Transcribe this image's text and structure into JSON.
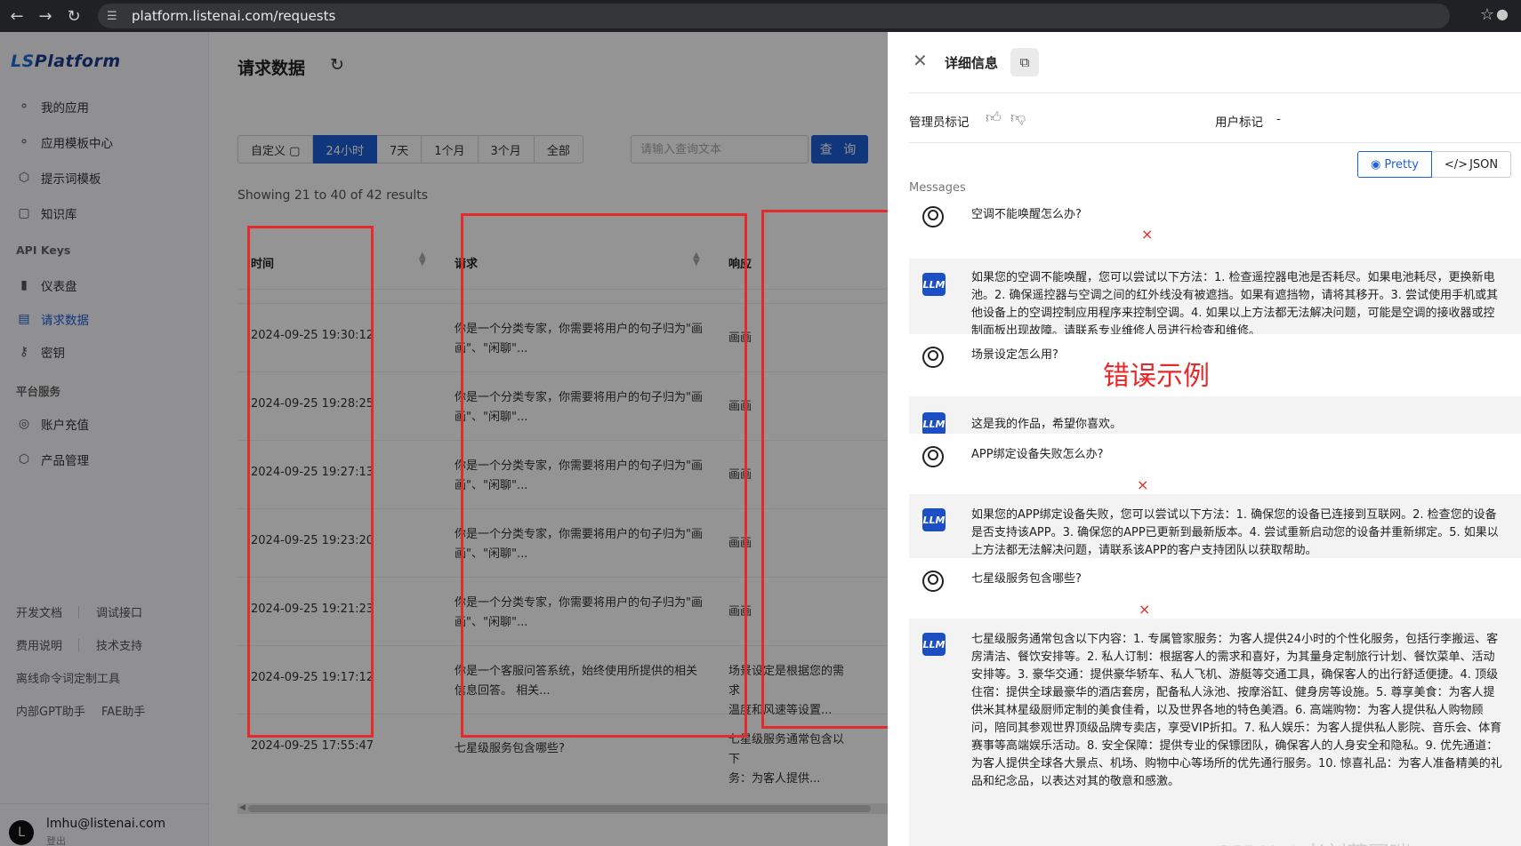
{
  "browser": {
    "url": "platform.listenai.com/requests"
  },
  "sidebar": {
    "logo_prefix": "LS",
    "logo_suffix": "Platform",
    "items": [
      {
        "label": "我的应用"
      },
      {
        "label": "应用模板中心"
      },
      {
        "label": "提示词模板"
      },
      {
        "label": "知识库"
      }
    ],
    "section_api": "API Keys",
    "api_items": [
      {
        "label": "仪表盘"
      },
      {
        "label": "请求数据"
      },
      {
        "label": "密钥"
      }
    ],
    "section_platform": "平台服务",
    "platform_items": [
      {
        "label": "账户充值"
      },
      {
        "label": "产品管理"
      }
    ],
    "links": [
      "开发文档",
      "调试接口",
      "费用说明",
      "技术支持",
      "离线命令词定制工具",
      "内部GPT助手",
      "FAE助手"
    ],
    "user_email": "lmhu@listenai.com",
    "user_avatar": "L",
    "logout": "登出"
  },
  "main": {
    "title": "请求数据",
    "filters": [
      "自定义 ▢",
      "24小时",
      "7天",
      "1个月",
      "3个月",
      "全部"
    ],
    "search_placeholder": "请输入查询文本",
    "search_button": "查 询",
    "showing": "Showing 21 to 40 of 42 results",
    "columns": [
      "时间",
      "请求",
      "响应"
    ],
    "rows": [
      {
        "time": "2024-09-25 19:30:12",
        "request": "你是一个分类专家，你需要将用户的句子归为\"画画\"、\"闲聊\"...",
        "response": "画画"
      },
      {
        "time": "2024-09-25 19:28:25",
        "request": "你是一个分类专家，你需要将用户的句子归为\"画画\"、\"闲聊\"...",
        "response": "画画"
      },
      {
        "time": "2024-09-25 19:27:13",
        "request": "你是一个分类专家，你需要将用户的句子归为\"画画\"、\"闲聊\"...",
        "response": "画画"
      },
      {
        "time": "2024-09-25 19:23:20",
        "request": "你是一个分类专家，你需要将用户的句子归为\"画画\"、\"闲聊\"...",
        "response": "画画"
      },
      {
        "time": "2024-09-25 19:21:23",
        "request": "你是一个分类专家，你需要将用户的句子归为\"画画\"、\"闲聊\"...",
        "response": "画画"
      },
      {
        "time": "2024-09-25 19:17:12",
        "request": "你是一个客服问答系统，始终使用所提供的相关信息回答。 相关...",
        "response": "场景设定是根据您的需求\n温度和风速等设置..."
      },
      {
        "time": "2024-09-25 17:55:47",
        "request": "七星级服务包含哪些?",
        "response": "七星级服务通常包含以下\n务：为客人提供..."
      }
    ]
  },
  "panel": {
    "title": "详细信息",
    "admin_label": "管理员标记",
    "user_mark_label": "用户标记",
    "user_mark_value": "-",
    "pretty": "Pretty",
    "json": "JSON",
    "messages_label": "Messages",
    "llm_badge": "LLM",
    "messages": [
      {
        "role": "user",
        "text": "空调不能唤醒怎么办?"
      },
      {
        "role": "llm",
        "text": "如果您的空调不能唤醒，您可以尝试以下方法：1. 检查遥控器电池是否耗尽。如果电池耗尽，更换新电池。2. 确保遥控器与空调之间的红外线没有被遮挡。如果有遮挡物，请将其移开。3. 尝试使用手机或其他设备上的空调控制应用程序来控制空调。4. 如果以上方法都无法解决问题，可能是空调的接收器或控制面板出现故障。请联系专业维修人员进行检查和维修。"
      },
      {
        "role": "user",
        "text": "场景设定怎么用?"
      },
      {
        "role": "llm",
        "text": "这是我的作品，希望你喜欢。"
      },
      {
        "role": "user",
        "text": "APP绑定设备失败怎么办?"
      },
      {
        "role": "llm",
        "text": "如果您的APP绑定设备失败，您可以尝试以下方法：1. 确保您的设备已连接到互联网。2. 检查您的设备是否支持该APP。3. 确保您的APP已更新到最新版本。4. 尝试重新启动您的设备并重新绑定。5. 如果以上方法都无法解决问题，请联系该APP的客户支持团队以获取帮助。"
      },
      {
        "role": "user",
        "text": "七星级服务包含哪些?"
      },
      {
        "role": "llm",
        "text": "七星级服务通常包含以下内容：1. 专属管家服务：为客人提供24小时的个性化服务，包括行李搬运、客房清洁、餐饮安排等。2. 私人订制：根据客人的需求和喜好，为其量身定制旅行计划、餐饮菜单、活动安排等。3. 豪华交通：提供豪华轿车、私人飞机、游艇等交通工具，确保客人的出行舒适便捷。4. 顶级住宿：提供全球最豪华的酒店套房，配备私人泳池、按摩浴缸、健身房等设施。5. 尊享美食：为客人提供米其林星级厨师定制的美食佳肴，以及世界各地的特色美酒。6. 高端购物：为客人提供私人购物顾问，陪同其参观世界顶级品牌专卖店，享受VIP折扣。7. 私人娱乐：为客人提供私人影院、音乐会、体育赛事等高端娱乐活动。8. 安全保障：提供专业的保镖团队，确保客人的人身安全和隐私。9. 优先通道：为客人提供全球各大景点、机场、购物中心等场所的优先通行服务。10. 惊喜礼品：为客人准备精美的礼品和纪念品，以表达对其的敬意和感激。"
      }
    ]
  },
  "annotations": {
    "mark": "×",
    "label": "错误示例",
    "color": "#e42a2a"
  },
  "watermark": "CSDN @老刘莱国瑞"
}
